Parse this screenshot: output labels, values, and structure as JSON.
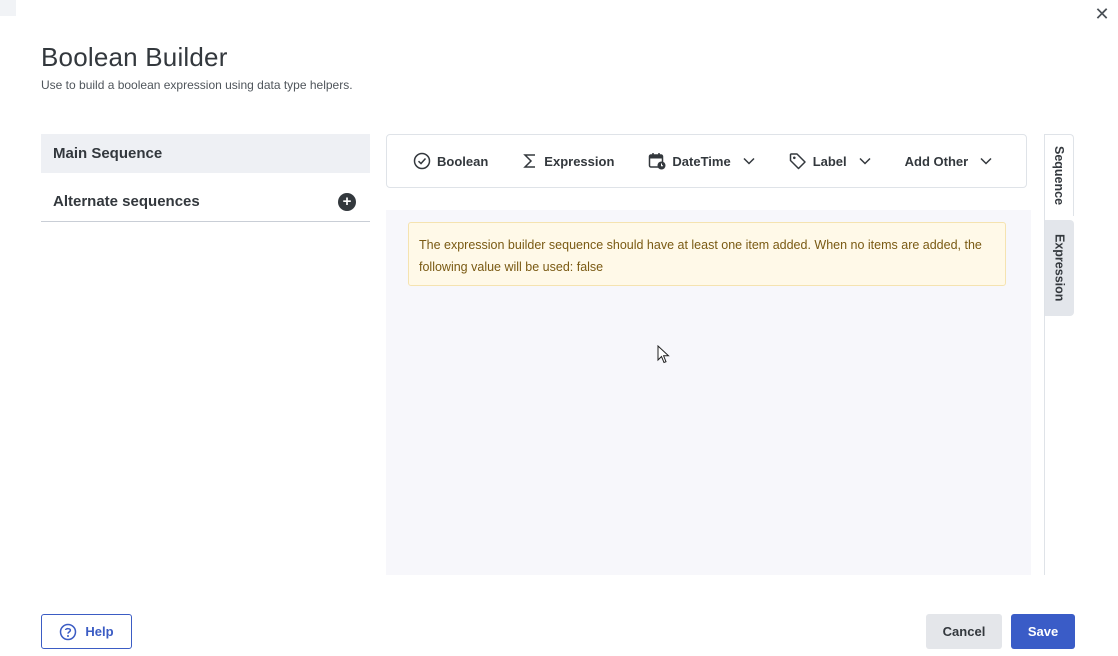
{
  "dialog": {
    "title": "Boolean Builder",
    "subtitle": "Use to build a boolean expression using data type helpers."
  },
  "sidebar": {
    "items": [
      {
        "label": "Main Sequence",
        "active": true
      },
      {
        "label": "Alternate sequences",
        "active": false
      }
    ]
  },
  "toolbar": {
    "boolean_label": "Boolean",
    "expression_label": "Expression",
    "datetime_label": "DateTime",
    "label_label": "Label",
    "add_other_label": "Add Other"
  },
  "canvas": {
    "warning_text": "The expression builder sequence should have at least one item added. When no items are added, the following value will be used: false"
  },
  "side_tabs": {
    "sequence_label": "Sequence",
    "expression_label": "Expression"
  },
  "footer": {
    "help_label": "Help",
    "cancel_label": "Cancel",
    "save_label": "Save"
  },
  "colors": {
    "accent": "#3a5cc7",
    "warning_bg": "#fff9e8",
    "warning_text": "#7a5a13"
  },
  "icons": [
    "close-icon",
    "add-icon",
    "check-circle-icon",
    "sigma-icon",
    "calendar-clock-icon",
    "tag-icon",
    "chevron-down-icon",
    "help-circle-icon",
    "cursor-icon"
  ]
}
